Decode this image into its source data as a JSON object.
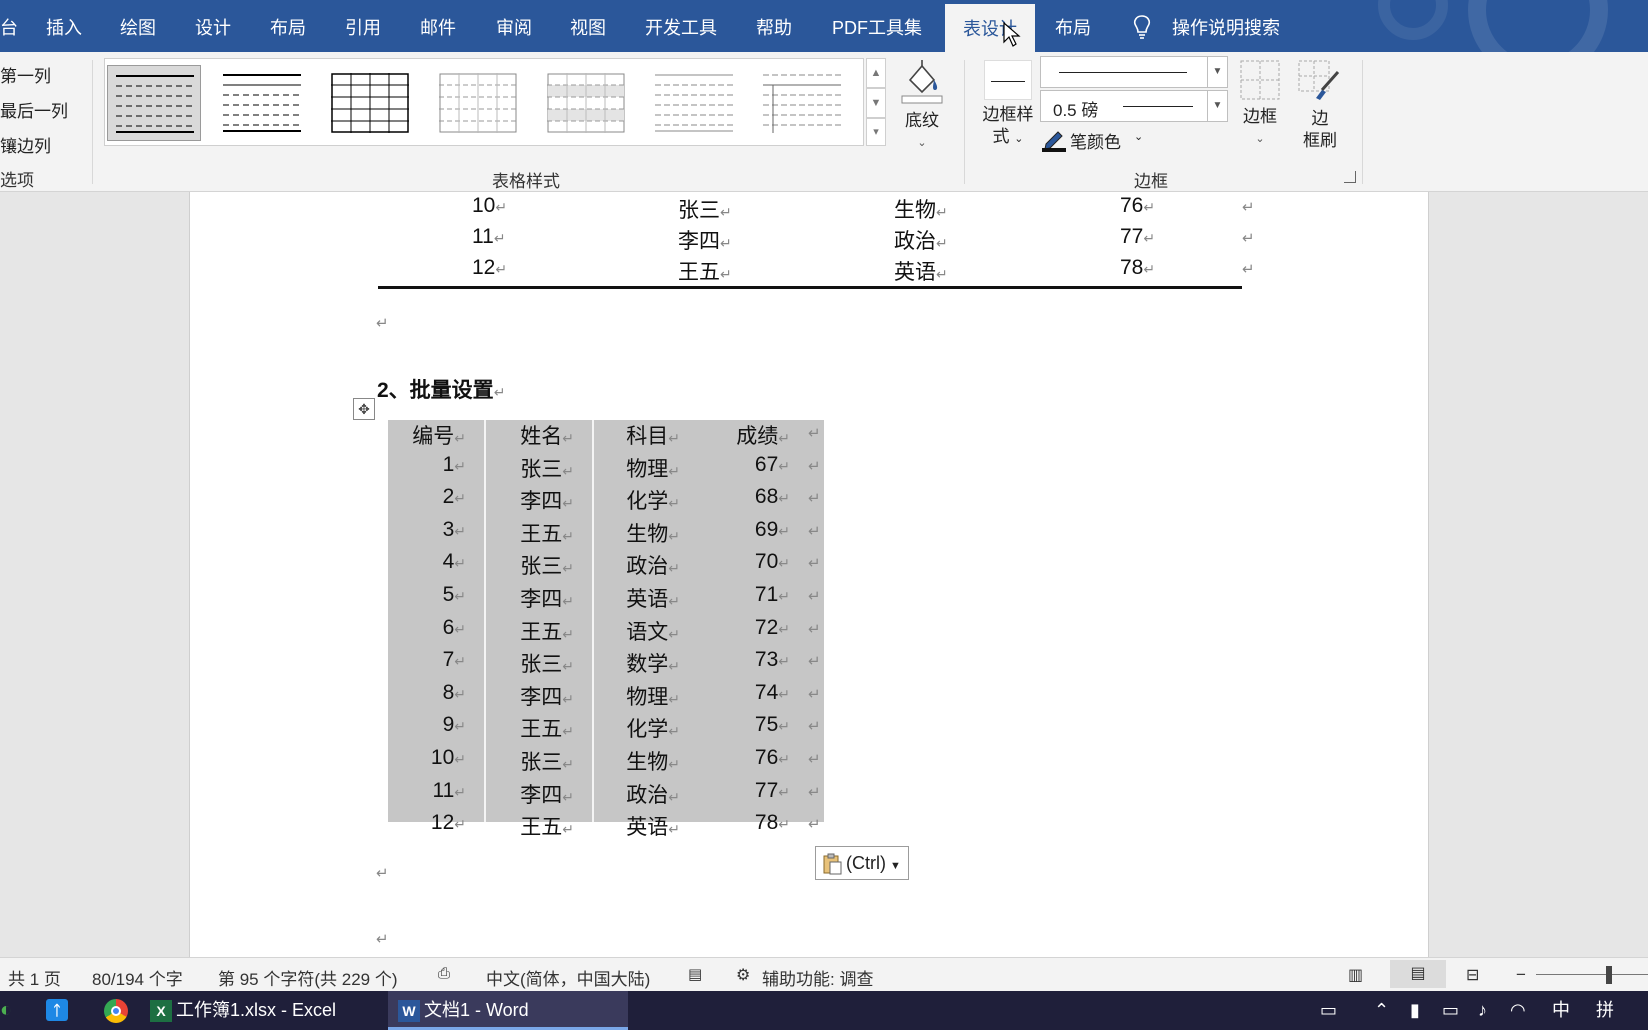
{
  "ribbon_tabs": [
    "台",
    "插入",
    "绘图",
    "设计",
    "布局",
    "引用",
    "邮件",
    "审阅",
    "视图",
    "开发工具",
    "帮助",
    "PDF工具集",
    "表设计",
    "布局"
  ],
  "active_tab": "表设计",
  "search_label": "操作说明搜索",
  "style_options": [
    "第一列",
    "最后一列",
    "镶边列",
    "选项"
  ],
  "table_styles_label": "表格样式",
  "shading_label": "底纹",
  "border_style_label": "边框样\n式",
  "border_style_line1": "边框样",
  "border_style_line2": "式",
  "pen_weight": "0.5 磅",
  "pen_color_label": "笔颜色",
  "borders_label": "边框",
  "border_painter_line1": "边",
  "border_painter_line2": "框刷",
  "border_group_label": "边框",
  "top_table_rows": [
    [
      "10",
      "张三",
      "生物",
      "76"
    ],
    [
      "11",
      "李四",
      "政治",
      "77"
    ],
    [
      "12",
      "王五",
      "英语",
      "78"
    ]
  ],
  "heading": "2、批量设置",
  "main_table": {
    "headers": [
      "编号",
      "姓名",
      "科目",
      "成绩"
    ],
    "rows": [
      [
        "1",
        "张三",
        "物理",
        "67"
      ],
      [
        "2",
        "李四",
        "化学",
        "68"
      ],
      [
        "3",
        "王五",
        "生物",
        "69"
      ],
      [
        "4",
        "张三",
        "政治",
        "70"
      ],
      [
        "5",
        "李四",
        "英语",
        "71"
      ],
      [
        "6",
        "王五",
        "语文",
        "72"
      ],
      [
        "7",
        "张三",
        "数学",
        "73"
      ],
      [
        "8",
        "李四",
        "物理",
        "74"
      ],
      [
        "9",
        "王五",
        "化学",
        "75"
      ],
      [
        "10",
        "张三",
        "生物",
        "76"
      ],
      [
        "11",
        "李四",
        "政治",
        "77"
      ],
      [
        "12",
        "王五",
        "英语",
        "78"
      ]
    ]
  },
  "paste_options_label": "(Ctrl)",
  "status": {
    "pages": "共 1 页",
    "words": "80/194 个字",
    "chars": "第 95 个字符(共 229 个)",
    "language": "中文(简体，中国大陆)",
    "accessibility": "辅助功能: 调查"
  },
  "taskbar": {
    "excel": "工作簿1.xlsx - Excel",
    "word": "文档1 - Word",
    "ime_lang": "中",
    "ime_mode": "拼"
  },
  "colors": {
    "title_bar": "#2b579a",
    "ribbon": "#f3f3f3",
    "selection": "#c6c6c6",
    "taskbar": "#1f1f3a"
  }
}
